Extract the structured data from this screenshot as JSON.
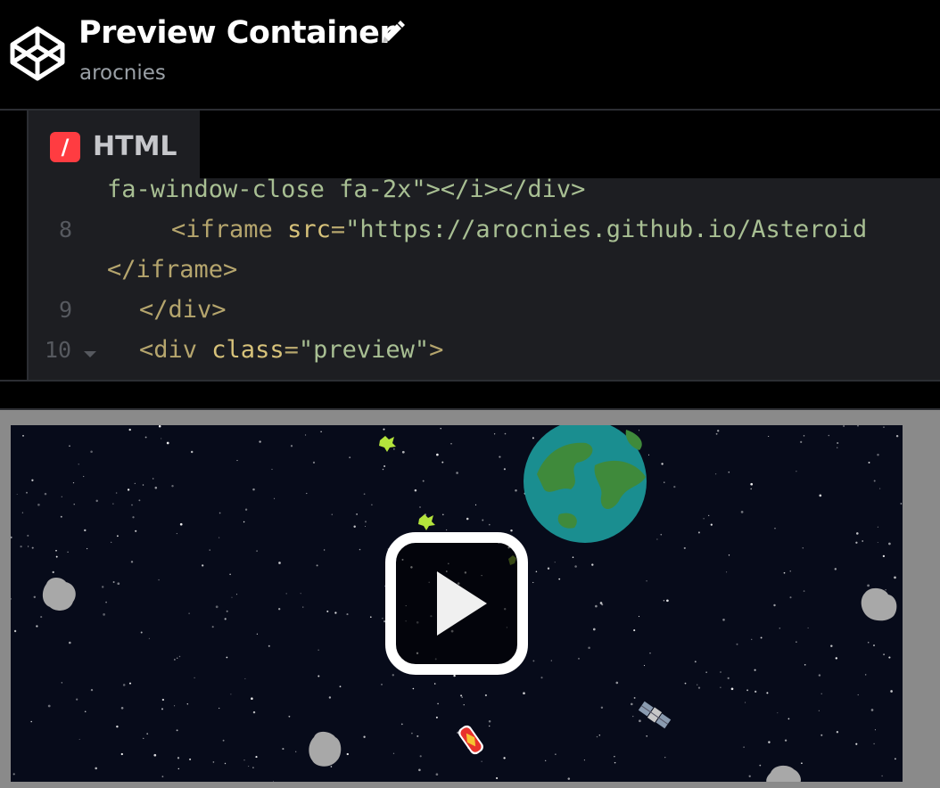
{
  "header": {
    "title": "Preview Container",
    "author": "arocnies",
    "logo_icon": "codepen-cube-icon",
    "edit_icon": "pencil-icon"
  },
  "editor": {
    "tab_label": "HTML",
    "tab_icon_glyph": "/",
    "tab_icon_color": "#ff3c41",
    "lines": {
      "l0": "fa-window-close fa-2x\"></i></div>",
      "l1_num": "8",
      "l1_tag_open": "<iframe",
      "l1_attr": "src",
      "l1_eq": "=",
      "l1_str": "\"https://arocnies.github.io/Asteroid",
      "l2": "</iframe>",
      "l3_num": "9",
      "l3": "</div>",
      "l4_num": "10",
      "l4_tag_open": "<div",
      "l4_attr": "class",
      "l4_eq": "=",
      "l4_str": "\"preview\"",
      "l4_close": ">"
    }
  },
  "preview": {
    "play_icon": "play-icon",
    "background_color": "#070b1a"
  }
}
